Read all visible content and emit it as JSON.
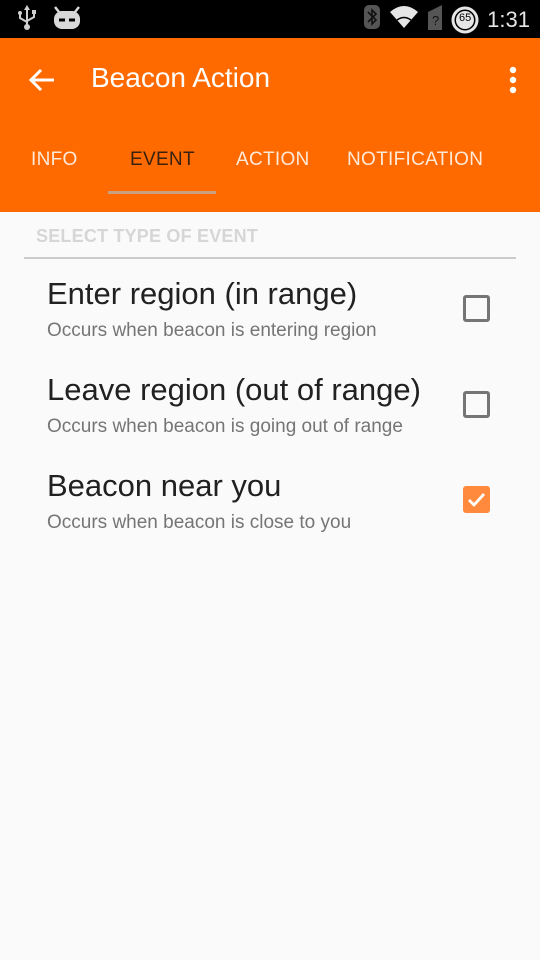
{
  "status_bar": {
    "left_icons": [
      "usb-icon",
      "cyanogenmod-icon"
    ],
    "right_icons": [
      "bluetooth-icon",
      "wifi-icon",
      "no-sim-icon",
      "battery-icon"
    ],
    "battery_level": "65",
    "time": "1:31"
  },
  "app_bar": {
    "back_icon": "arrow-back-icon",
    "title": "Beacon Action",
    "more_icon": "more-vert-icon"
  },
  "tabs": [
    {
      "label": "INFO",
      "active": false
    },
    {
      "label": "EVENT",
      "active": true
    },
    {
      "label": "ACTION",
      "active": false
    },
    {
      "label": "NOTIFICATION",
      "active": false
    }
  ],
  "section": {
    "header": "SELECT TYPE OF EVENT"
  },
  "events": [
    {
      "title": "Enter region (in range)",
      "subtitle": "Occurs when beacon is entering region",
      "checked": false
    },
    {
      "title": "Leave region (out of range)",
      "subtitle": "Occurs when beacon is going out of range",
      "checked": false
    },
    {
      "title": "Beacon near you",
      "subtitle": "Occurs when beacon is close to you",
      "checked": true
    }
  ],
  "colors": {
    "primary": "#ff6a00",
    "accent": "#ff8a3d",
    "status_bar": "#000000",
    "background": "#fafafa"
  }
}
